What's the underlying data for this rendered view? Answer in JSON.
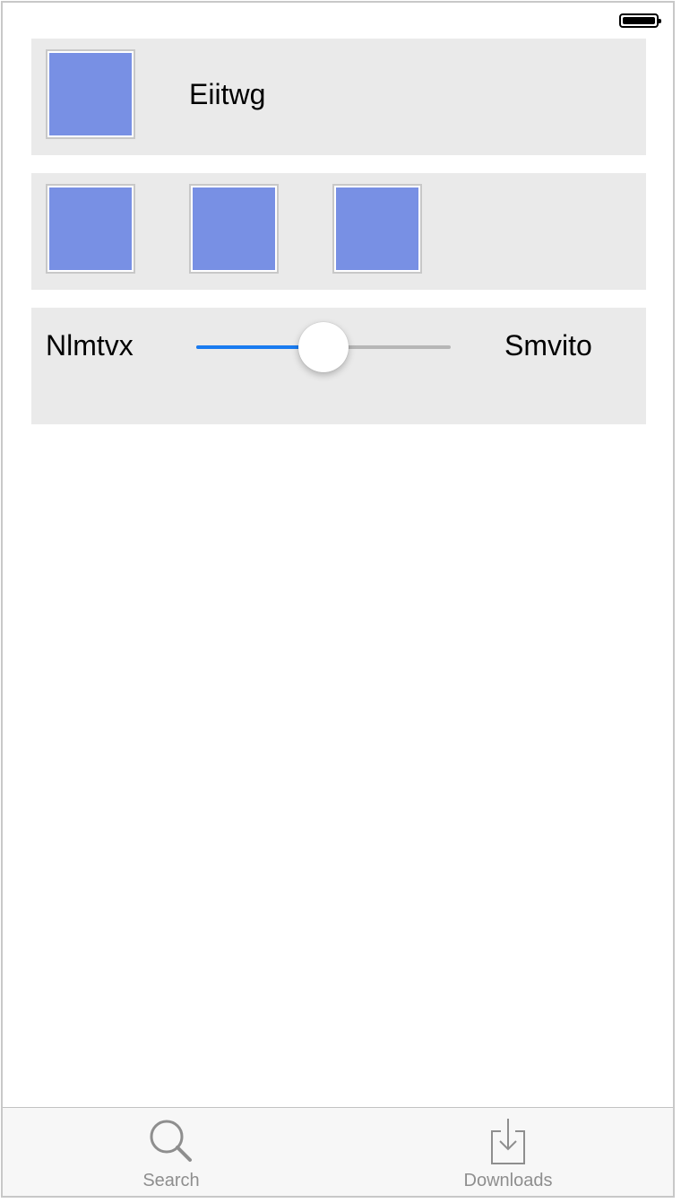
{
  "status_bar": {
    "battery_level": 1.0
  },
  "rows": [
    {
      "label": "Eiitwg"
    },
    {
      "tiles": 3
    },
    {
      "slider": {
        "min_label": "Nlmtvx",
        "max_label": "Smvito",
        "value": 0.5
      }
    }
  ],
  "tab_bar": {
    "items": [
      {
        "label": "Search",
        "icon": "search-icon"
      },
      {
        "label": "Downloads",
        "icon": "downloads-icon"
      }
    ]
  },
  "colors": {
    "tile": "#7890e4",
    "slider_fill": "#1a7bf0",
    "panel": "#eaeaea"
  }
}
